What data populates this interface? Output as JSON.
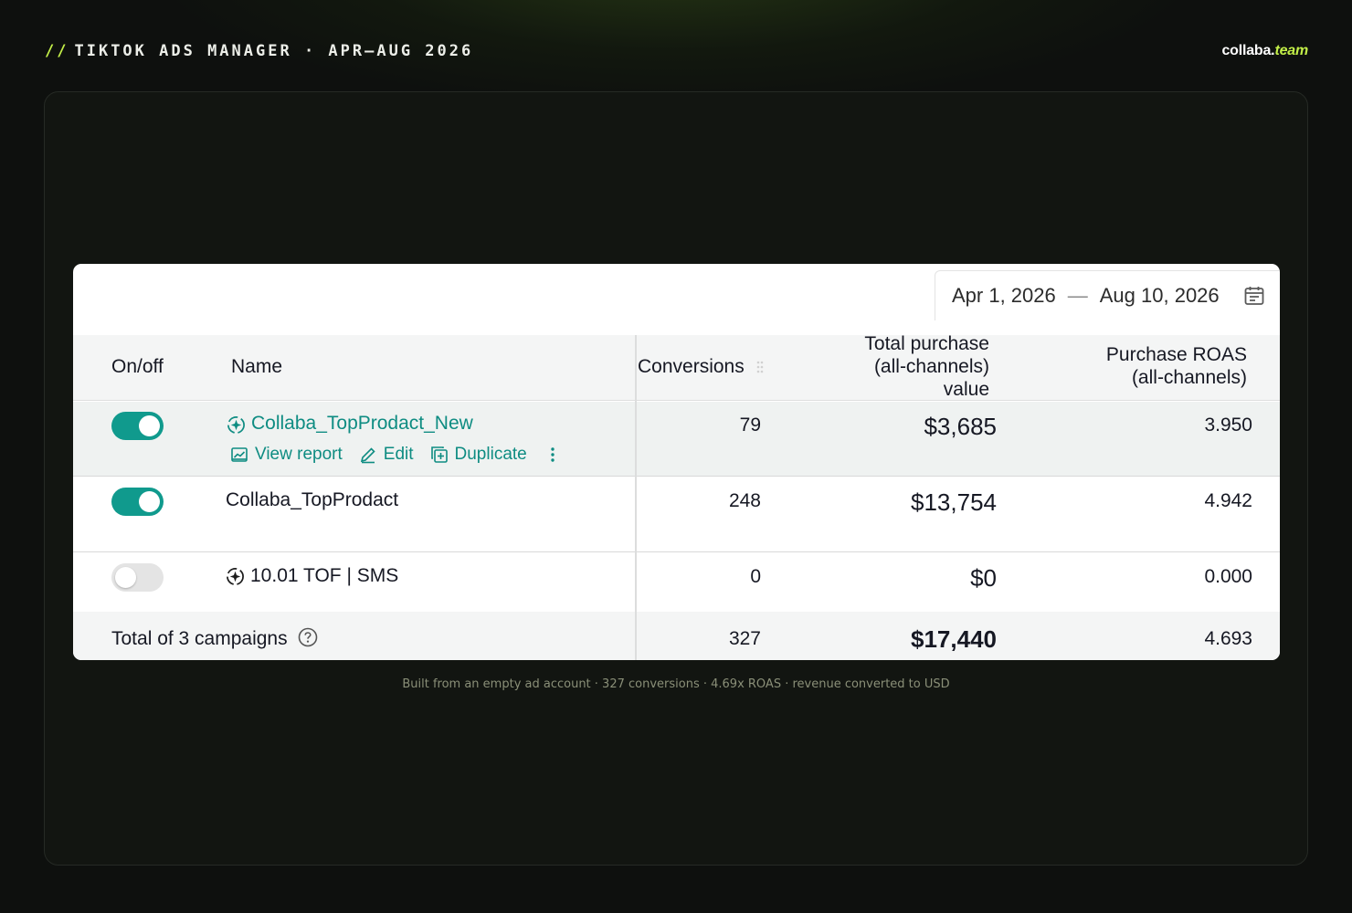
{
  "header": {
    "slashes": "//",
    "title": "TIKTOK ADS MANAGER · APR–AUG 2026",
    "brand_main": "collaba.",
    "brand_accent": "team",
    "accent_color": "#c3ef48"
  },
  "date_range": {
    "start": "Apr 1, 2026",
    "separator": "—",
    "end": "Aug 10, 2026",
    "icon": "calendar-icon"
  },
  "table": {
    "columns": {
      "onoff": "On/off",
      "name": "Name",
      "conversions": "Conversions",
      "value_line1": "Total purchase",
      "value_line2": "(all-channels)",
      "value_line3": "value",
      "roas_line1": "Purchase ROAS",
      "roas_line2": "(all-channels)"
    },
    "rows": [
      {
        "enabled": true,
        "name": "Collaba_TopProdact_New",
        "icon": "spark-icon",
        "conversions": "79",
        "value": "$3,685",
        "roas": "3.950",
        "actions": {
          "view_report": "View report",
          "edit": "Edit",
          "duplicate": "Duplicate"
        }
      },
      {
        "enabled": true,
        "name": "Collaba_TopProdact",
        "conversions": "248",
        "value": "$13,754",
        "roas": "4.942"
      },
      {
        "enabled": false,
        "name": "10.01 TOF | SMS",
        "icon": "spark-icon",
        "conversions": "0",
        "value": "$0",
        "roas": "0.000"
      }
    ],
    "total": {
      "label": "Total of 3 campaigns",
      "conversions": "327",
      "value": "$17,440",
      "roas": "4.693"
    },
    "toggle_on_color": "#109a8d",
    "link_color": "#0e8c82"
  },
  "footnote": "Built from an empty ad account · 327 conversions · 4.69x ROAS · revenue converted to USD"
}
